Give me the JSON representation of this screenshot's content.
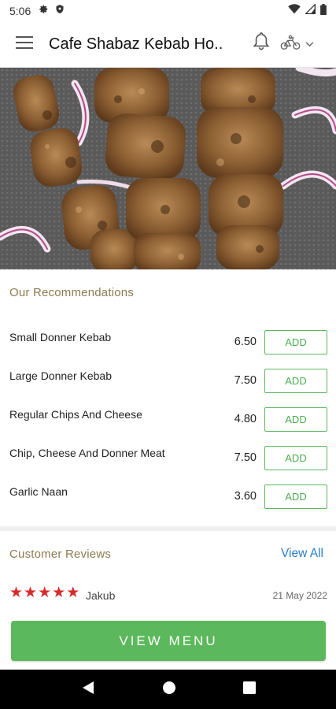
{
  "status_bar": {
    "time": "5:06",
    "left_icons": [
      "gear-icon",
      "shield-icon"
    ],
    "right_icons": [
      "wifi-icon",
      "signal-icon",
      "battery-icon"
    ]
  },
  "app_bar": {
    "title": "Cafe Shabaz Kebab Ho..",
    "icons": [
      "hamburger-menu-icon",
      "bell-icon",
      "delivery-bike-icon",
      "chevron-down-icon"
    ]
  },
  "hero": {
    "alt": "Chicken kebab skewers with red onion"
  },
  "recommendations": {
    "title": "Our Recommendations",
    "add_label": "ADD",
    "items": [
      {
        "name": "Small Donner Kebab",
        "price": "6.50"
      },
      {
        "name": "Large Donner Kebab",
        "price": "7.50"
      },
      {
        "name": "Regular Chips And Cheese",
        "price": "4.80"
      },
      {
        "name": "Chip, Cheese And Donner Meat",
        "price": "7.50"
      },
      {
        "name": "Garlic Naan",
        "price": "3.60"
      }
    ]
  },
  "reviews": {
    "title": "Customer Reviews",
    "view_all": "View All",
    "items": [
      {
        "rating": 5,
        "reviewer": "Jakub",
        "date": "21 May 2022"
      }
    ]
  },
  "cta": {
    "label": "VIEW MENU"
  },
  "nav_bar": {
    "icons": [
      "back-icon",
      "home-icon",
      "recents-icon"
    ]
  },
  "colors": {
    "accent_green": "#5cb85c",
    "section_title": "#8d7b4f",
    "link_blue": "#2a7fc4",
    "star_red": "#d62b2b"
  }
}
